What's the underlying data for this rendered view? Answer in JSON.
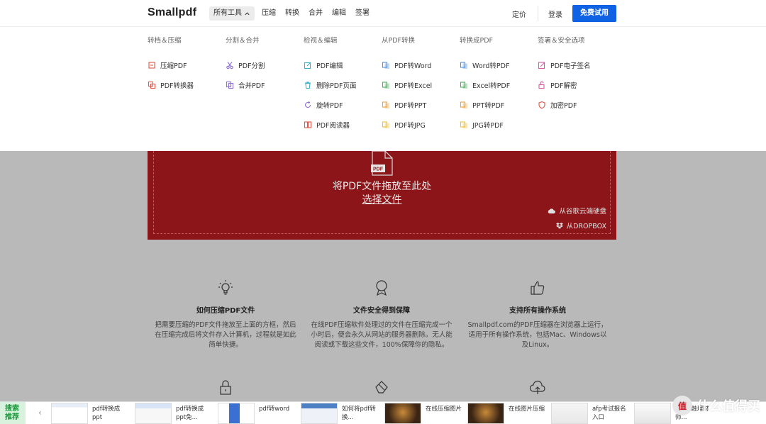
{
  "header": {
    "logo": "Smallpdf",
    "nav": [
      "所有工具",
      "压缩",
      "转换",
      "合并",
      "编辑",
      "签署"
    ],
    "price": "定价",
    "login": "登录",
    "trial": "免费试用"
  },
  "dropdown": {
    "columns": [
      {
        "title": "转档＆压缩",
        "items": [
          {
            "label": "压缩PDF",
            "icon": "compress-icon",
            "color": "#e2574c"
          },
          {
            "label": "PDF转换器",
            "icon": "convert-icon",
            "color": "#e2574c"
          }
        ]
      },
      {
        "title": "分割＆合并",
        "items": [
          {
            "label": "PDF分割",
            "icon": "scissors-icon",
            "color": "#8e6fd6"
          },
          {
            "label": "合并PDF",
            "icon": "merge-icon",
            "color": "#8e6fd6"
          }
        ]
      },
      {
        "title": "检视＆编辑",
        "items": [
          {
            "label": "PDF编辑",
            "icon": "edit-icon",
            "color": "#3bb0c9"
          },
          {
            "label": "删除PDF页面",
            "icon": "trash-icon",
            "color": "#3bb0c9"
          },
          {
            "label": "旋转PDF",
            "icon": "rotate-icon",
            "color": "#8e6fd6"
          },
          {
            "label": "PDF阅读器",
            "icon": "reader-icon",
            "color": "#e2574c"
          }
        ]
      },
      {
        "title": "从PDF转换",
        "items": [
          {
            "label": "PDF转Word",
            "icon": "pdf-word-icon",
            "color": "#4a8fe7"
          },
          {
            "label": "PDF转Excel",
            "icon": "pdf-excel-icon",
            "color": "#45b058"
          },
          {
            "label": "PDF转PPT",
            "icon": "pdf-ppt-icon",
            "color": "#f0a030"
          },
          {
            "label": "PDF转JPG",
            "icon": "pdf-jpg-icon",
            "color": "#f0c030"
          }
        ]
      },
      {
        "title": "转换成PDF",
        "items": [
          {
            "label": "Word转PDF",
            "icon": "word-pdf-icon",
            "color": "#4a8fe7"
          },
          {
            "label": "Excel转PDF",
            "icon": "excel-pdf-icon",
            "color": "#45b058"
          },
          {
            "label": "PPT转PDF",
            "icon": "ppt-pdf-icon",
            "color": "#f0a030"
          },
          {
            "label": "JPG转PDF",
            "icon": "jpg-pdf-icon",
            "color": "#f0c030"
          }
        ]
      },
      {
        "title": "签署＆安全选项",
        "items": [
          {
            "label": "PDF电子签名",
            "icon": "sign-icon",
            "color": "#d65ca0"
          },
          {
            "label": "PDF解密",
            "icon": "unlock-icon",
            "color": "#d65ca0"
          },
          {
            "label": "加密PDF",
            "icon": "shield-icon",
            "color": "#e2574c"
          }
        ]
      }
    ]
  },
  "dropzone": {
    "file_badge": "PDF",
    "main_text": "将PDF文件拖放至此处",
    "choose_text": "选择文件",
    "google_drive": "从谷歌云端硬盘",
    "dropbox": "从DROPBOX"
  },
  "features": [
    {
      "title": "如何压缩PDF文件",
      "desc": "把需要压缩的PDF文件拖放至上面的方框，然后在压缩完成后将文件存入计算机，过程就是如此简单快捷。",
      "icon": "lightbulb-icon"
    },
    {
      "title": "文件安全得到保障",
      "desc": "在线PDF压缩软件处理过的文件在压缩完成一个小时后，便会永久从网站的服务器删除。无人能阅读或下载这些文件，100%保障你的隐私。",
      "icon": "award-icon"
    },
    {
      "title": "支持所有操作系统",
      "desc": "Smallpdf.com的PDF压缩器在浏览器上运行，适用于所有操作系统，包括Mac、Windows以及Linux。",
      "icon": "thumbs-up-icon"
    }
  ],
  "bottom": {
    "label": "搜索推荐",
    "items": [
      {
        "text": "pdf转换成ppt"
      },
      {
        "text": "pdf转换成ppt免..."
      },
      {
        "text": "pdf转word"
      },
      {
        "text": "如何将pdf转换..."
      },
      {
        "text": "在线压缩图片"
      },
      {
        "text": "在线图片压缩"
      },
      {
        "text": "afp考试报名入口"
      },
      {
        "text": "afp金融理财师..."
      }
    ]
  },
  "watermark": {
    "badge": "值",
    "text": "什么值得买"
  }
}
